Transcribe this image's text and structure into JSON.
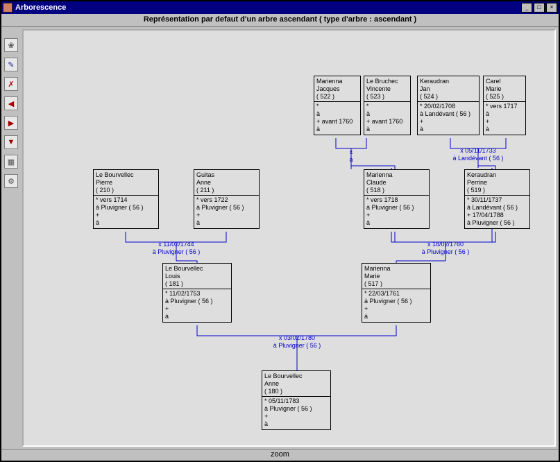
{
  "window": {
    "title": "Arborescence"
  },
  "header": {
    "title": "Représentation par defaut d'un arbre ascendant ( type d'arbre : ascendant )"
  },
  "footer": {
    "label": "zoom"
  },
  "toolbar": {
    "icons": [
      "tree-root-icon",
      "edit-icon",
      "person-remove-icon",
      "person-left-icon",
      "person-right-icon",
      "person-down-icon",
      "table-icon",
      "settings-icon"
    ]
  },
  "win_buttons": {
    "min": "_",
    "max": "□",
    "close": "×"
  },
  "people": {
    "p522": {
      "surname": "Marienna",
      "given": "Jacques",
      "id": "( 522 )",
      "b": "*",
      "bp": "à",
      "d": "+ avant 1760",
      "dp": "à"
    },
    "p523": {
      "surname": "Le Bruchec",
      "given": "Vincente",
      "id": "( 523 )",
      "b": "*",
      "bp": "à",
      "d": "+ avant 1760",
      "dp": "à"
    },
    "p524": {
      "surname": "Keraudran",
      "given": "Jan",
      "id": "( 524 )",
      "b": "* 20/02/1708",
      "bp": "à Landévant ( 56 )",
      "d": "+",
      "dp": "à"
    },
    "p525": {
      "surname": "Carel",
      "given": "Marie",
      "id": "( 525 )",
      "b": "* vers 1717",
      "bp": "à",
      "d": "+",
      "dp": "à"
    },
    "p210": {
      "surname": "Le Bourvellec",
      "given": "Pierre",
      "id": "( 210 )",
      "b": "* vers 1714",
      "bp": "à Pluvigner ( 56 )",
      "d": "+",
      "dp": "à"
    },
    "p211": {
      "surname": "Guitas",
      "given": "Anne",
      "id": "( 211 )",
      "b": "* vers 1722",
      "bp": "à Pluvigner ( 56 )",
      "d": "+",
      "dp": "à"
    },
    "p518": {
      "surname": "Marienna",
      "given": "Claude",
      "id": "( 518 )",
      "b": "* vers 1718",
      "bp": "à Pluvigner ( 56 )",
      "d": "+",
      "dp": "à"
    },
    "p519": {
      "surname": "Keraudran",
      "given": "Perrine",
      "id": "( 519 )",
      "b": "* 30/11/1737",
      "bp": "à Landévant ( 56 )",
      "d": "+ 17/04/1788",
      "dp": "à Pluvigner ( 56 )"
    },
    "p181": {
      "surname": "Le Bourvellec",
      "given": "Louis",
      "id": "( 181 )",
      "b": "* 11/02/1753",
      "bp": "à Pluvigner ( 56 )",
      "d": "+",
      "dp": "à"
    },
    "p517": {
      "surname": "Marienna",
      "given": "Marie",
      "id": "( 517 )",
      "b": "* 22/03/1761",
      "bp": "à Pluvigner ( 56 )",
      "d": "+",
      "dp": "à"
    },
    "p180": {
      "surname": "Le Bourvellec",
      "given": "Anne",
      "id": "( 180 )",
      "b": "* 05/11/1783",
      "bp": "à Pluvigner ( 56 )",
      "d": "+",
      "dp": "à"
    }
  },
  "marriages": {
    "m522_523": {
      "line1": "x",
      "line2": "à"
    },
    "m524_525": {
      "line1": "x 05/11/1733",
      "line2": "à Landévant ( 56 )"
    },
    "m210_211": {
      "line1": "x 11/02/1744",
      "line2": "à Pluvigner ( 56 )"
    },
    "m518_519": {
      "line1": "x 18/02/1760",
      "line2": "à Pluvigner ( 56 )"
    },
    "m181_517": {
      "line1": "x 03/02/1780",
      "line2": "à Pluvigner ( 56 )"
    }
  }
}
